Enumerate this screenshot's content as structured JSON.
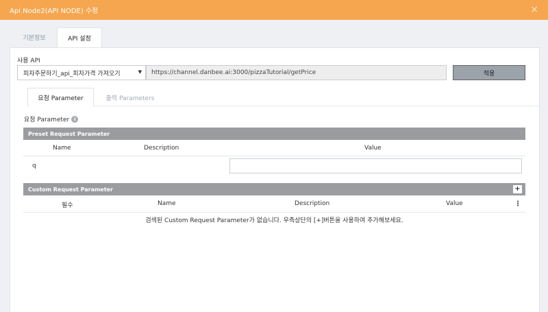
{
  "dialog": {
    "title": "Api Node2(API NODE) 수정",
    "close_glyph": "×"
  },
  "tabs": [
    {
      "label": "기본정보",
      "active": false
    },
    {
      "label": "API 설정",
      "active": true
    }
  ],
  "api": {
    "label": "사용 API",
    "selected": "피자주문하기_api_피자가격 가져오기",
    "url": "https://channel.danbee.ai:3000/pizzaTutorial/getPrice",
    "apply_label": "적용"
  },
  "subtabs": [
    {
      "label": "요청 Parameter",
      "active": true
    },
    {
      "label": "출력 Parameters",
      "active": false
    }
  ],
  "request": {
    "title": "요청 Parameter",
    "info_glyph": "i",
    "preset": {
      "header": "Preset Request Parameter",
      "columns": [
        "Name",
        "Description",
        "Value"
      ],
      "rows": [
        {
          "name": "q",
          "description": "",
          "value": ""
        }
      ]
    },
    "custom": {
      "header": "Custom Request Parameter",
      "add_glyph": "+",
      "columns": [
        "필수",
        "Name",
        "Description",
        "Value"
      ],
      "menu_glyph": "⋮",
      "empty_message": "검색된 Custom Request Parameter가 없습니다. 우측상단의 [+]버튼을 사용하여 추가해보세요."
    }
  },
  "colors": {
    "titlebar": "#f6a64f",
    "section_header": "#9a9c9f",
    "apply_button": "#9ca3ab"
  }
}
